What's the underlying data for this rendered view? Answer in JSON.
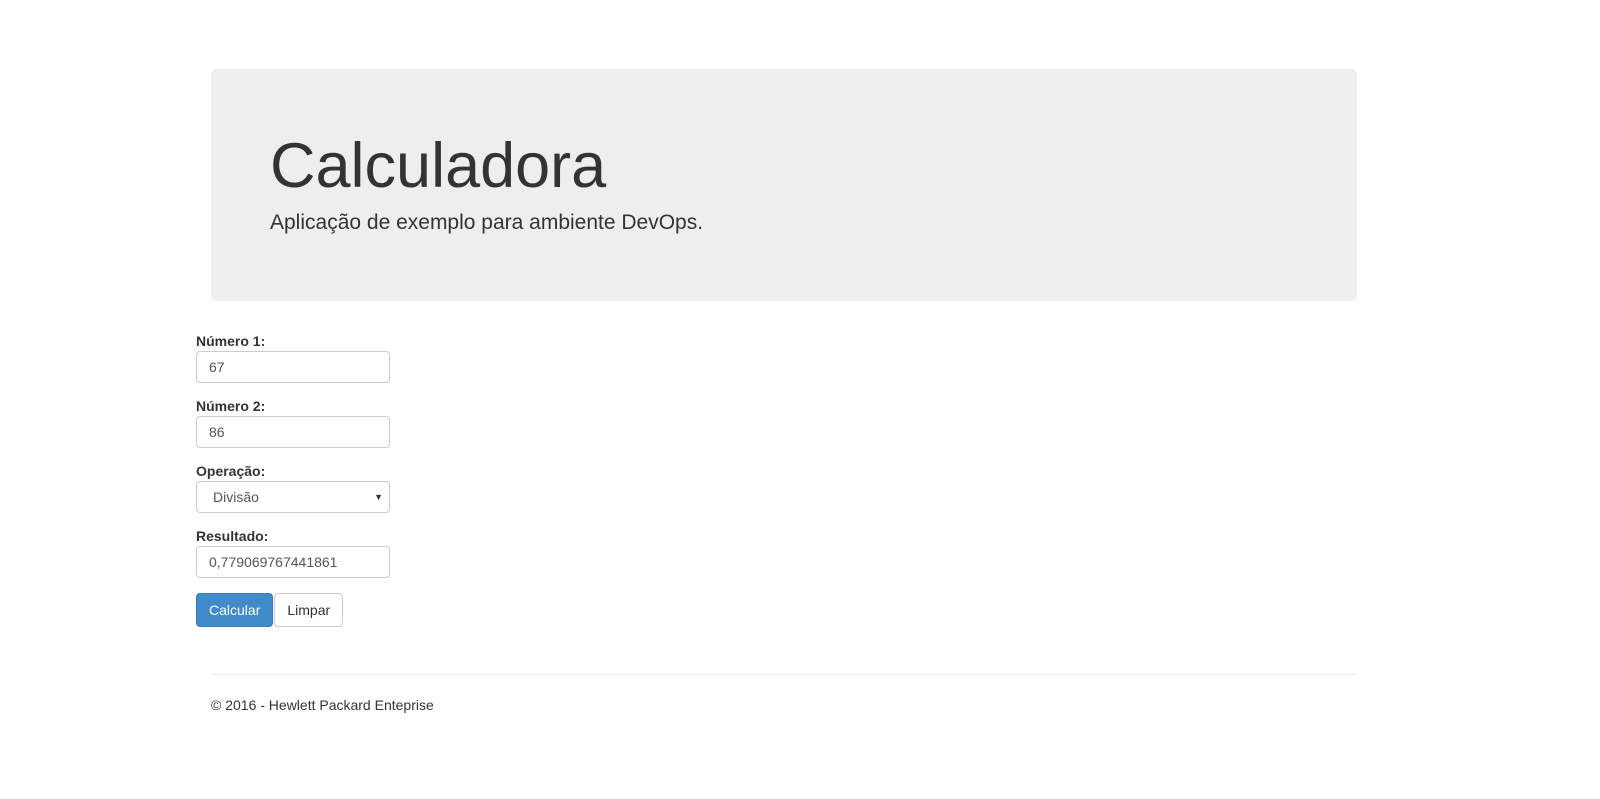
{
  "header": {
    "title": "Calculadora",
    "subtitle": "Aplicação de exemplo para ambiente DevOps."
  },
  "form": {
    "num1_label": "Número 1:",
    "num1_value": "67",
    "num2_label": "Número 2:",
    "num2_value": "86",
    "op_label": "Operação:",
    "op_value": "Divisão",
    "result_label": "Resultado:",
    "result_value": "0,779069767441861",
    "calc_label": "Calcular",
    "clear_label": "Limpar"
  },
  "footer": {
    "text": "© 2016 - Hewlett Packard Enteprise"
  }
}
